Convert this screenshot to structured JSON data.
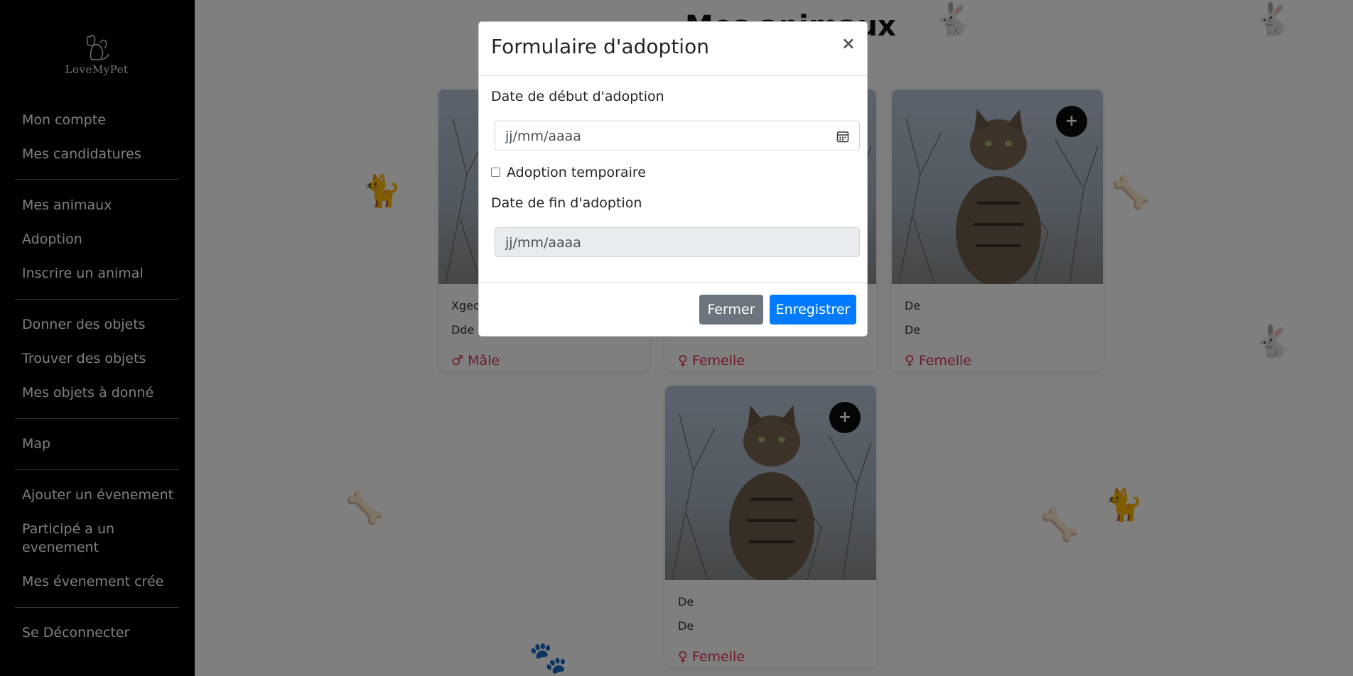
{
  "sidebar": {
    "logo_text": "LoveMyPet",
    "items": [
      {
        "label": "Mon compte"
      },
      {
        "label": "Mes candidatures"
      },
      {
        "label": "Mes animaux"
      },
      {
        "label": "Adoption"
      },
      {
        "label": "Inscrire un animal"
      },
      {
        "label": "Donner des objets"
      },
      {
        "label": "Trouver des objets"
      },
      {
        "label": "Mes objets à donné"
      },
      {
        "label": "Map"
      },
      {
        "label": "Ajouter un évenement"
      },
      {
        "label": "Participé a un evenement"
      },
      {
        "label": "Mes évenement crée"
      },
      {
        "label": "Se Déconnecter"
      }
    ]
  },
  "main": {
    "page_title": "Mes animaux",
    "cards": [
      {
        "line1": "Xgeo",
        "line2": "Dde",
        "gender_symbol": "♂",
        "gender": "Mâle",
        "add_label": "+"
      },
      {
        "line1": "",
        "line2": "",
        "gender_symbol": "♀",
        "gender": "Femelle",
        "add_label": "+"
      },
      {
        "line1": "De",
        "line2": "De",
        "gender_symbol": "♀",
        "gender": "Femelle",
        "add_label": "+"
      },
      {
        "line1": "De",
        "line2": "De",
        "gender_symbol": "♀",
        "gender": "Femelle",
        "add_label": "+"
      }
    ]
  },
  "modal": {
    "title": "Formulaire d'adoption",
    "close_symbol": "×",
    "start_label": "Date de début d'adoption",
    "start_placeholder": "jj/mm/aaaa",
    "temporary_label": "Adoption temporaire",
    "end_label": "Date de fin d'adoption",
    "end_placeholder": "jj/mm/aaaa",
    "close_button": "Fermer",
    "save_button": "Enregistrer"
  },
  "colors": {
    "sidebar_bg": "#000000",
    "primary": "#007bff",
    "secondary": "#6c757d",
    "female": "#dc3545"
  }
}
